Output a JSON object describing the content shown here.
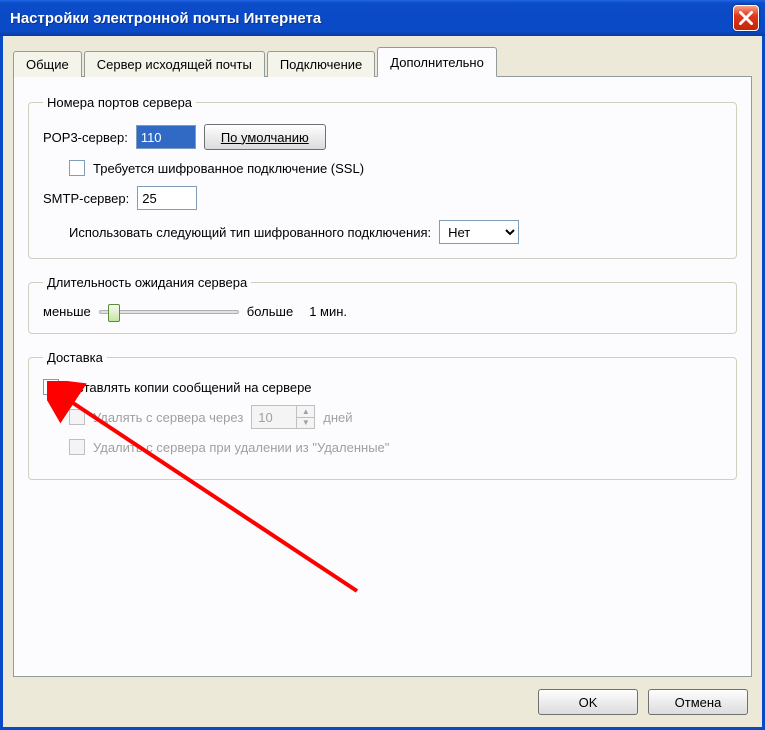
{
  "window": {
    "title": "Настройки электронной почты Интернета"
  },
  "tabs": {
    "general": "Общие",
    "outgoing": "Сервер исходящей почты",
    "connection": "Подключение",
    "advanced": "Дополнительно"
  },
  "ports": {
    "legend": "Номера портов сервера",
    "pop3_label": "POP3-сервер:",
    "pop3_value": "110",
    "defaults_btn": "По умолчанию",
    "ssl_label": "Требуется шифрованное подключение (SSL)",
    "smtp_label": "SMTP-сервер:",
    "smtp_value": "25",
    "enc_type_label": "Использовать следующий тип шифрованного подключения:",
    "enc_type_value": "Нет"
  },
  "timeout": {
    "legend": "Длительность ожидания сервера",
    "less": "меньше",
    "more": "больше",
    "value": "1 мин."
  },
  "delivery": {
    "legend": "Доставка",
    "leave_copy": "Оставлять копии сообщений на сервере",
    "remove_after": "Удалять с сервера через",
    "remove_after_days_value": "10",
    "days_label": "дней",
    "remove_on_delete": "Удалить с сервера при удалении из \"Удаленные\""
  },
  "buttons": {
    "ok": "OK",
    "cancel": "Отмена"
  }
}
